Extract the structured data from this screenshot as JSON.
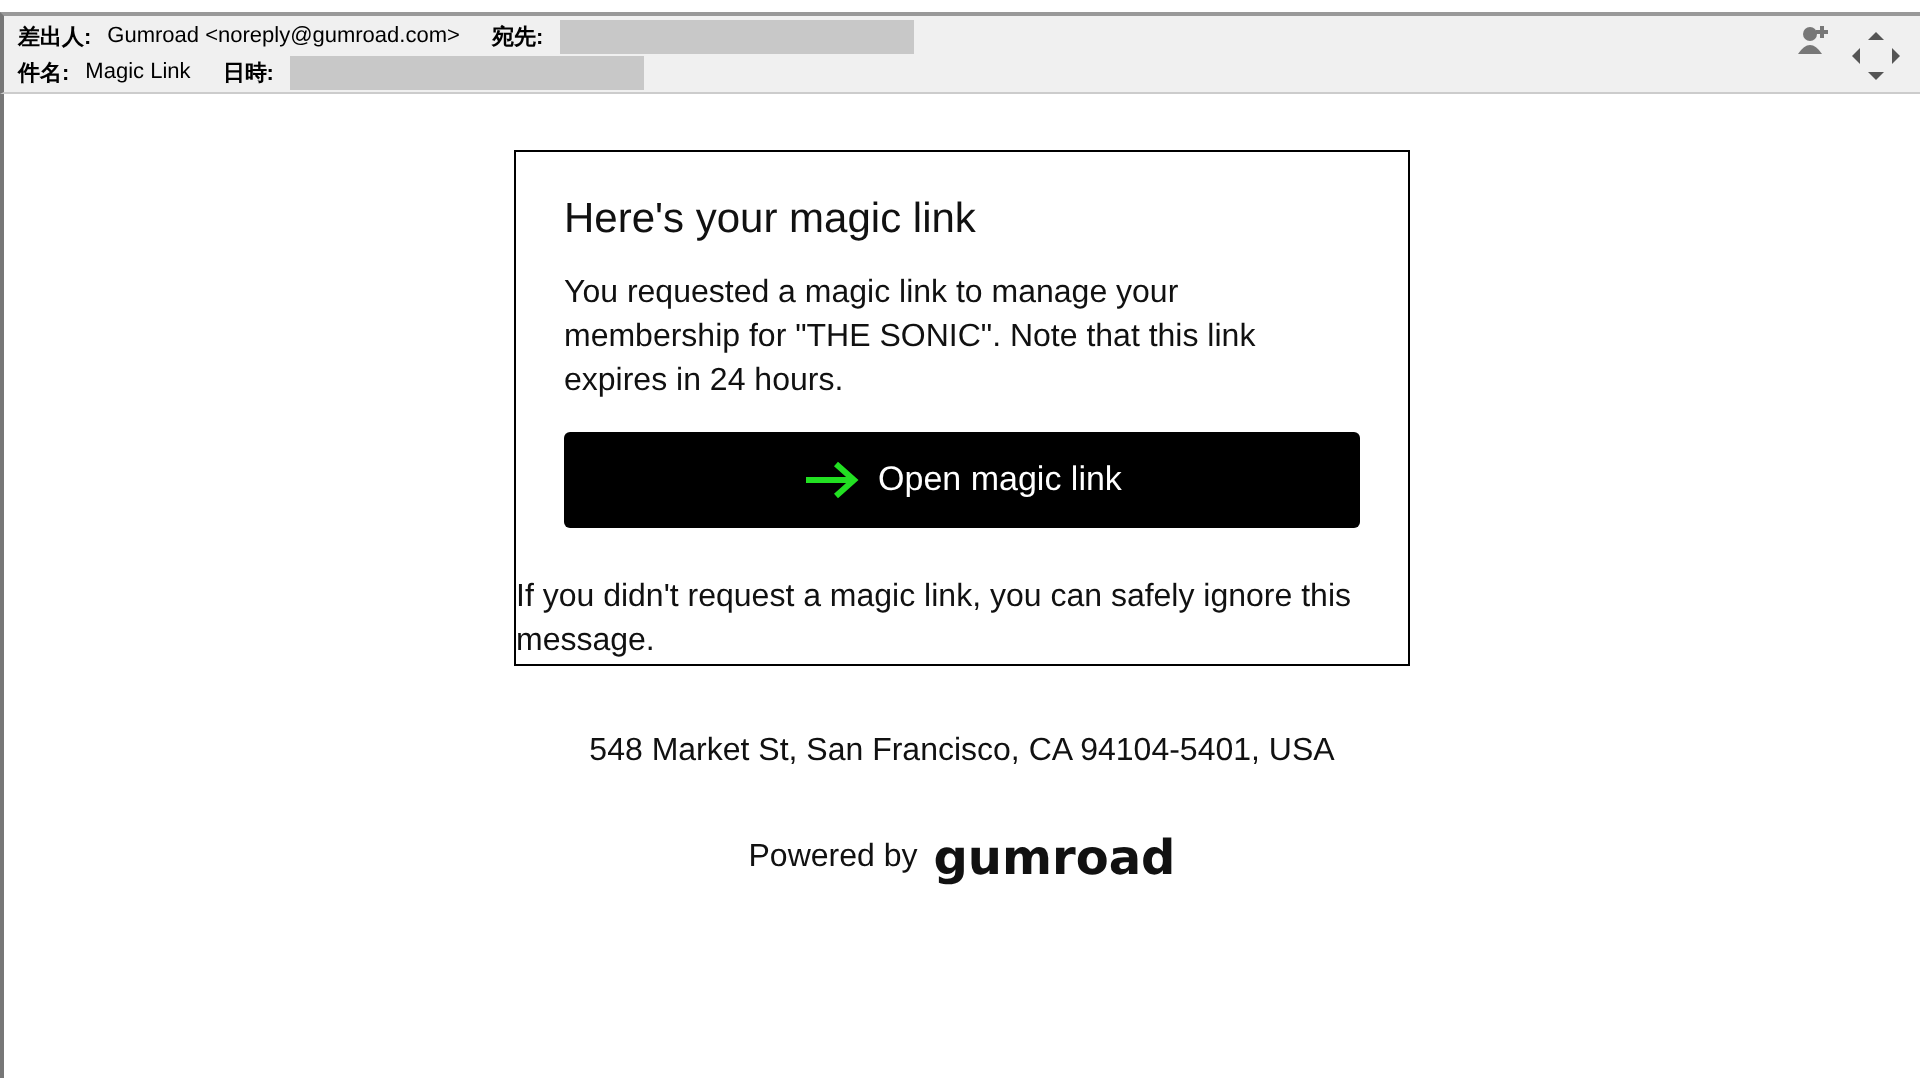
{
  "header": {
    "from_label": "差出人:",
    "from_value": "Gumroad <noreply@gumroad.com>",
    "to_label": "宛先:",
    "to_redacted": true,
    "subject_label": "件名:",
    "subject_value": "Magic Link",
    "date_label": "日時:",
    "date_redacted": true
  },
  "email": {
    "title": "Here's your magic link",
    "body": "You requested a magic link to manage your membership for \"THE SONIC\". Note that this link expires in 24 hours.",
    "button": "Open magic link",
    "note": "If you didn't request a magic link, you can safely ignore this message."
  },
  "footer": {
    "address": "548 Market St, San Francisco, CA 94104-5401, USA",
    "powered_by": "Powered by",
    "brand": "gumroad"
  }
}
